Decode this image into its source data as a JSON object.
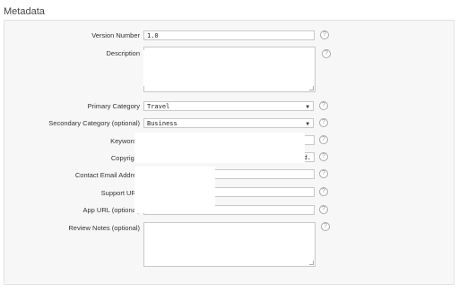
{
  "section": {
    "title": "Metadata"
  },
  "fields": {
    "version_number": {
      "label": "Version Number",
      "value": "1.0"
    },
    "description": {
      "label": "Description",
      "value": ""
    },
    "primary_category": {
      "label": "Primary Category",
      "value": "Travel"
    },
    "secondary_category": {
      "label": "Secondary Category (optional)",
      "value": "Business"
    },
    "keywords": {
      "label": "Keywords",
      "value": ""
    },
    "copyright": {
      "label": "Copyright",
      "value": "d."
    },
    "contact_email": {
      "label": "Contact Email Addres",
      "value": ""
    },
    "support_url": {
      "label": "Support URL",
      "value": ""
    },
    "app_url": {
      "label": "App URL (optional)",
      "value": ""
    },
    "review_notes": {
      "label": "Review Notes (optional)",
      "value": ""
    }
  },
  "help_glyph": "?",
  "icons": {
    "help": "question-circle-icon",
    "dropdown": "chevron-down-icon",
    "resize": "resize-grip-icon"
  }
}
